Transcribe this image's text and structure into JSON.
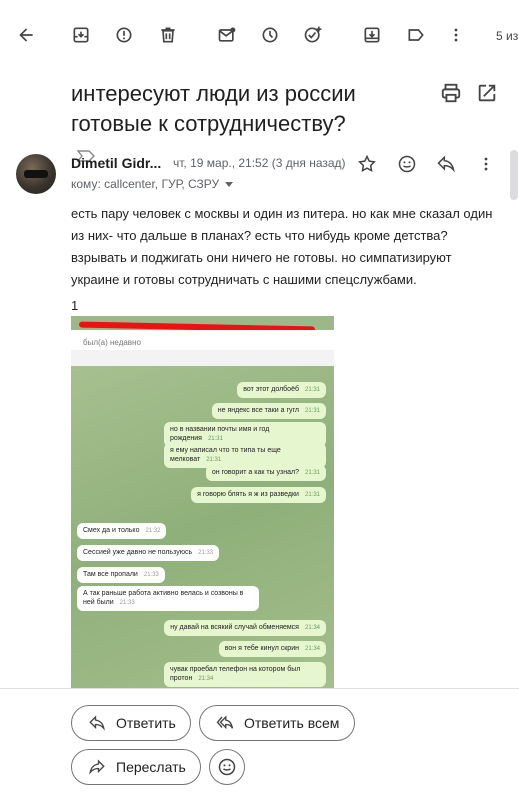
{
  "toolbar": {
    "icons": [
      "back-arrow-icon",
      "archive-icon",
      "report-spam-icon",
      "delete-icon",
      "mark-unread-icon",
      "snooze-icon",
      "add-to-tasks-icon",
      "move-to-icon",
      "label-icon",
      "more-vert-icon"
    ],
    "count": "5 из"
  },
  "email": {
    "subject": "интересуют люди из россии готовые к сотрудничеству?",
    "sender": "Dimetil Gidr...",
    "date": "чт, 19 мар., 21:52 (3 дня назад)",
    "recipients": "кому: callcenter, ГУР, СЗРУ",
    "body": "есть пару человек с москвы и один из питера. но как мне сказал один из них-  что дальше в планах? есть что нибудь кроме детства? взрывать и поджигать они ничего не готовы. но симпатизируют украине и готовы сотрудничать с нашими спецслужбами.",
    "attachment_number": "1"
  },
  "screenshot": {
    "status": "был(а) недавно",
    "messages": [
      {
        "dir": "out",
        "text": "вот этот долбоёб",
        "time": "21:31"
      },
      {
        "dir": "out",
        "text": "не яндекс все таки а гугл",
        "time": "21:31"
      },
      {
        "dir": "out",
        "text": "но в названии почты имя и год рождения",
        "time": "21:31"
      },
      {
        "dir": "out",
        "text": "я ему написал что то типа ты еще мелковат",
        "time": "21:31"
      },
      {
        "dir": "out",
        "text": "он говорит а как ты узнал?",
        "time": "21:31"
      },
      {
        "dir": "out",
        "text": "я говорю блять я ж из разведки",
        "time": "21:31"
      },
      {
        "dir": "in",
        "text": "Смех да и только",
        "time": "21:32"
      },
      {
        "dir": "in",
        "text": "Сессией уже давно не пользуюсь",
        "time": "21:33"
      },
      {
        "dir": "in",
        "text": "Там все пропали",
        "time": "21:33"
      },
      {
        "dir": "in",
        "text": "А так раньше работа активно велась и созвоны в ней были",
        "time": "21:33"
      },
      {
        "dir": "out",
        "text": "ну давай на всякий случай обменяемся",
        "time": "21:34"
      },
      {
        "dir": "out",
        "text": "вон я тебе кинул скрин",
        "time": "21:34"
      },
      {
        "dir": "out",
        "text": "чувак проебал телефон на котором был протон",
        "time": "21:34"
      }
    ]
  },
  "actions": {
    "reply": "Ответить",
    "reply_all": "Ответить всем",
    "forward": "Переслать"
  }
}
